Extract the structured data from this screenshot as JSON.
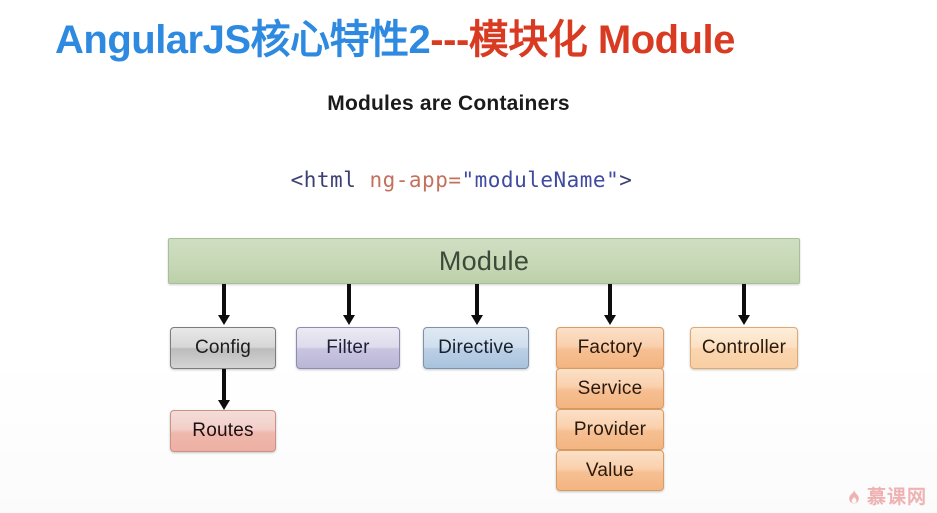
{
  "slide": {
    "title": {
      "blue_part": "AngularJS核心特性2",
      "red_part": "---模块化 Module",
      "blue_color": "#2e8ae0",
      "red_color": "#d93b22"
    },
    "subtitle": "Modules are Containers",
    "code": {
      "tag_open": "<html ",
      "attribute": "ng-app=",
      "value": "\"moduleName\"",
      "tag_close": ">",
      "tag_color": "#3c3f72",
      "attr_color": "#c4705d",
      "value_color": "#3f4aa0"
    },
    "diagram": {
      "root": {
        "label": "Module",
        "fill": "#c7d8b6",
        "border": "#a8bf97"
      },
      "children": [
        {
          "label": "Config",
          "style": "gray",
          "fill": "#d6d6d6"
        },
        {
          "label": "Filter",
          "style": "purple",
          "fill": "#dedbeb"
        },
        {
          "label": "Directive",
          "style": "blue",
          "fill": "#cfdeee"
        },
        {
          "label": "Factory",
          "style": "peach",
          "fill": "#fad0ad"
        },
        {
          "label": "Controller",
          "style": "peach-light",
          "fill": "#fce0c2"
        }
      ],
      "factory_stack": [
        {
          "label": "Service",
          "style": "peach"
        },
        {
          "label": "Provider",
          "style": "peach"
        },
        {
          "label": "Value",
          "style": "peach"
        }
      ],
      "config_child": {
        "label": "Routes",
        "style": "pink",
        "fill": "#efb8ad"
      }
    },
    "watermark": {
      "text": "慕课网",
      "icon": "flame-icon",
      "color": "#e05a5a"
    }
  }
}
